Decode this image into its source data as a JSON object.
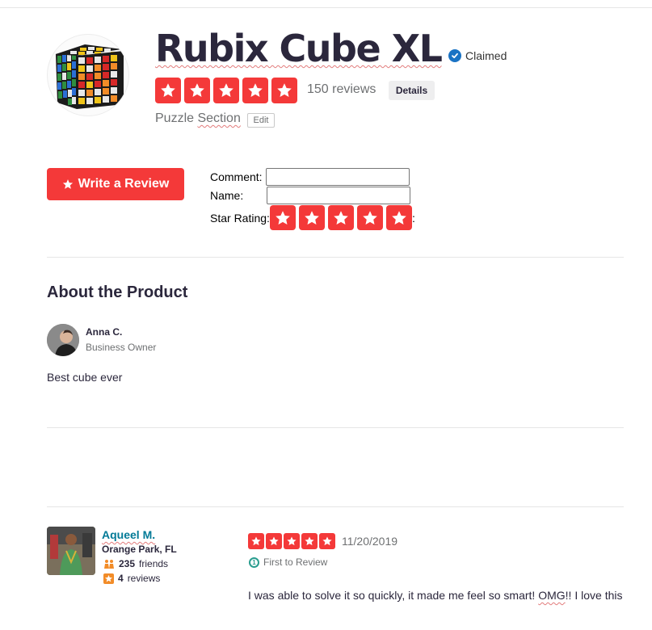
{
  "product": {
    "title": "Rubix Cube XL",
    "claimed_label": "Claimed",
    "rating": 5,
    "reviews_count": "150 reviews",
    "details_label": "Details",
    "category": "Puzzle Section",
    "edit_label": "Edit",
    "logo_icon": "rubiks-cube-icon"
  },
  "review_form": {
    "write_review_label": "Write a Review",
    "comment_label": "Comment:",
    "comment_value": "",
    "name_label": "Name:",
    "name_value": "",
    "star_rating_label": "Star Rating:",
    "star_rating_suffix": ":",
    "star_count": 5
  },
  "about": {
    "title": "About the Product",
    "owner_name": "Anna C.",
    "owner_role": "Business Owner",
    "text": "Best cube ever"
  },
  "review": {
    "reviewer_name": "Aqueel M.",
    "reviewer_location": "Orange Park, FL",
    "friends_count": "235",
    "friends_label": "friends",
    "reviews_count": "4",
    "reviews_label": "reviews",
    "rating": 5,
    "date": "11/20/2019",
    "badge_label": "First to Review",
    "text_before": "I was able to solve it so quickly, it made me feel so smart! ",
    "text_highlight": "OMG",
    "text_after": "!! I love this"
  },
  "colors": {
    "accent_red": "#f43939",
    "link_teal": "#027a97",
    "claimed_blue": "#1a73c4"
  }
}
